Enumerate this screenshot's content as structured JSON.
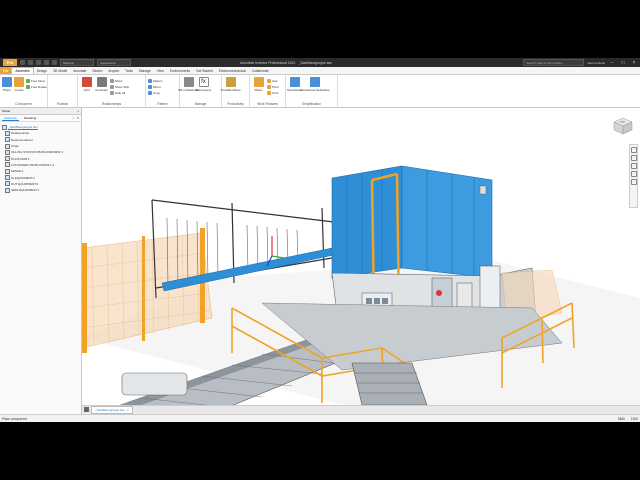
{
  "title_bar": {
    "material": "Material",
    "appearance": "Appearance",
    "app_title": "Autodesk Inventor Professional 2021",
    "file_title": "_StartBausgruppe.iam",
    "search_placeholder": "Search Help & Commands...",
    "user": "luka.rechenik"
  },
  "tabs": [
    "File",
    "Assemble",
    "Design",
    "3D Model",
    "Annotate",
    "Sketch",
    "Inspect",
    "Tools",
    "Manage",
    "View",
    "Environments",
    "Get Started",
    "Electromechanical",
    "Collaborate"
  ],
  "active_tab": "Assemble",
  "ribbon": {
    "component": {
      "title": "Component",
      "place": "Place",
      "create": "Create",
      "free_move": "Free Move",
      "free_rotate": "Free Rotate"
    },
    "position": {
      "title": "Position"
    },
    "relationships": {
      "title": "Relationships",
      "joint": "Joint",
      "constrain": "Constrain",
      "show": "Show",
      "show_sick": "Show Sick",
      "hide_all": "Hide All"
    },
    "pattern": {
      "title": "Pattern",
      "pattern": "Pattern",
      "mirror": "Mirror",
      "copy": "Copy"
    },
    "manage": {
      "title": "Manage",
      "bom": "Bill of Materials",
      "parameters": "Parameters"
    },
    "productivity": {
      "title": "Productivity",
      "shrinkwrap_boot": "Simplified Boot"
    },
    "work_features": {
      "title": "Work Features",
      "plane": "Plane",
      "axis": "Axis",
      "point": "Point",
      "ucs": "UCS"
    },
    "simplification": {
      "title": "Simplification",
      "shrinkwrap": "Shrinkwrap",
      "shrinkwrap_substitute": "Shrinkwrap Substitute"
    }
  },
  "browser": {
    "header": "Model",
    "tabs": [
      "Assembly",
      "Modeling"
    ],
    "items": [
      "_StartBausgruppe.iam",
      "Relationships",
      "Representations",
      "Origin",
      "FILLING STATION FB150-003033FR:1",
      "PLATFORM:1",
      "CONTAINER FB150-003033-1:1",
      "FENCE:1",
      "IN EQUIPMENT:2",
      "OUT EQUIPMENT:2",
      "SEMI EQUIPMENT:1"
    ]
  },
  "viewcube": {
    "label": "TOP"
  },
  "doc_tab": {
    "name": "_StartBausgruppe.iam"
  },
  "status": {
    "left": "Place component",
    "right1": "9480",
    "right2": "1500"
  },
  "colors": {
    "accent": "#e8a33d",
    "machine_blue": "#2f8fd6",
    "rail_yellow": "#f0a327",
    "selection": "#2a7ad2"
  }
}
